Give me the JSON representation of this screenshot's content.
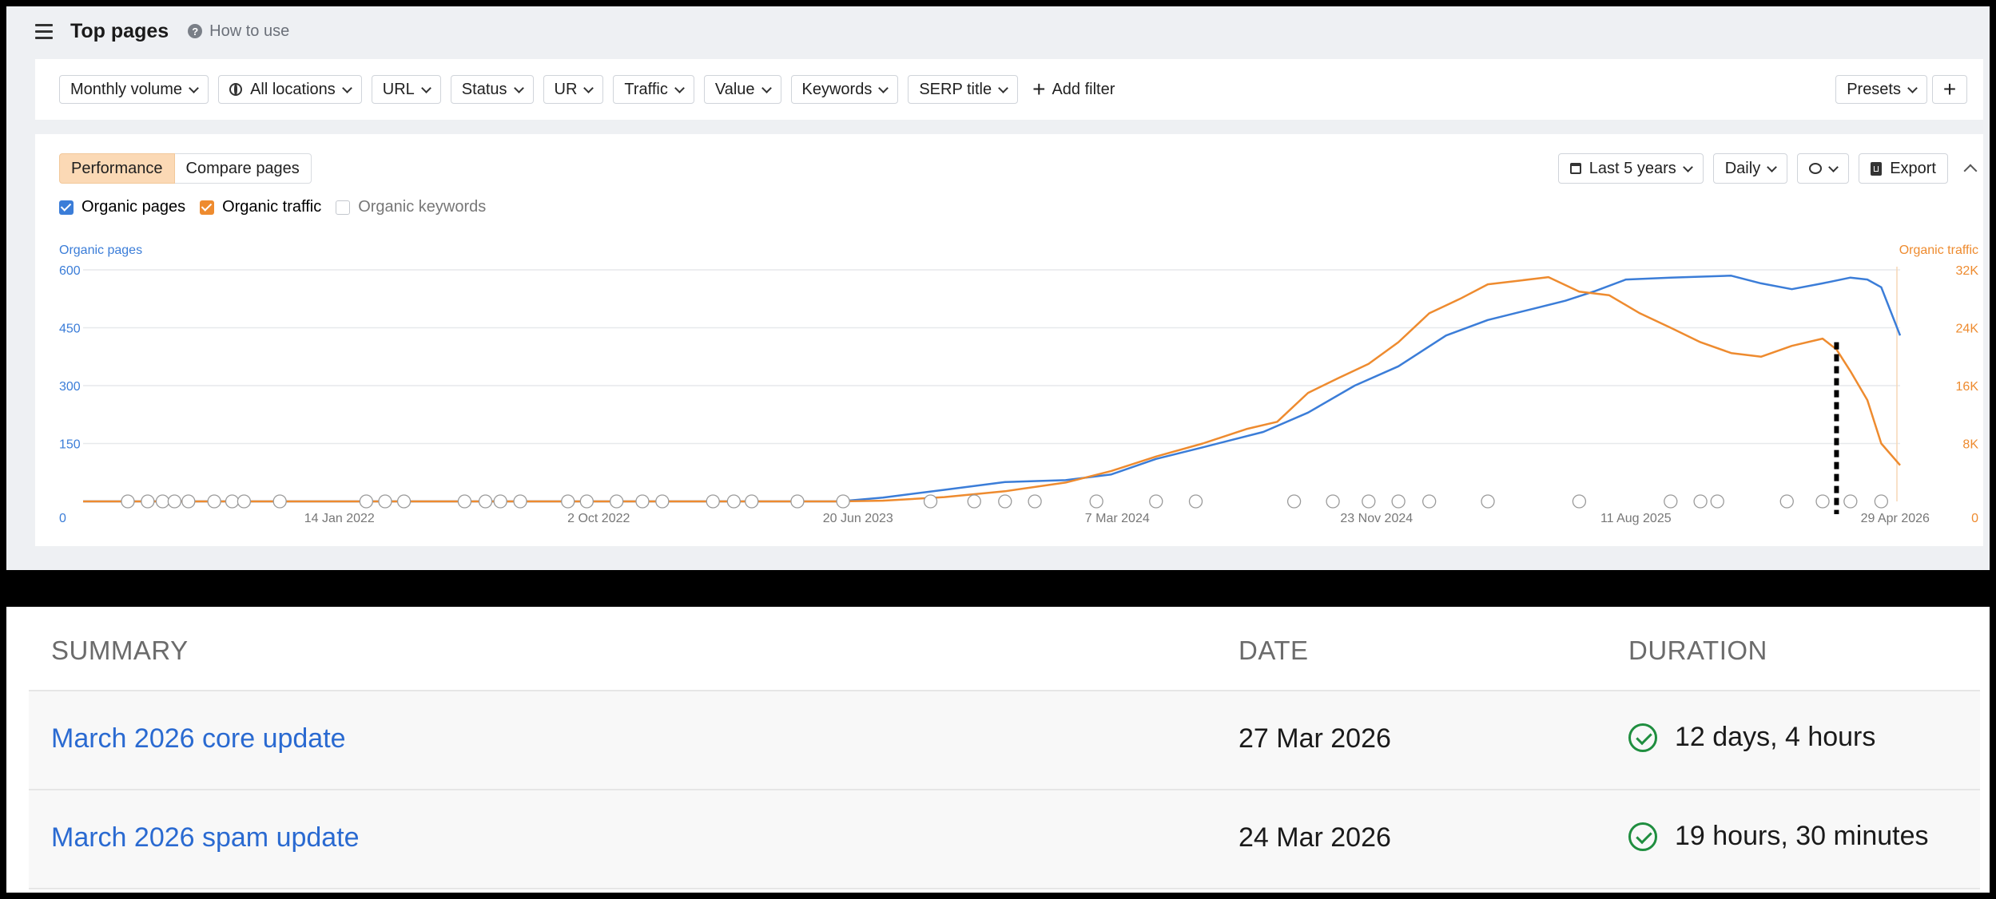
{
  "header": {
    "title": "Top pages",
    "help_label": "How to use",
    "help_icon": "question-circle-icon"
  },
  "filters": {
    "chips": [
      {
        "label": "Monthly volume"
      },
      {
        "label": "All locations",
        "icon": "globe-icon"
      },
      {
        "label": "URL"
      },
      {
        "label": "Status"
      },
      {
        "label": "UR"
      },
      {
        "label": "Traffic"
      },
      {
        "label": "Value"
      },
      {
        "label": "Keywords"
      },
      {
        "label": "SERP title"
      }
    ],
    "add_filter": "Add filter",
    "presets": "Presets",
    "add_symbol": "+"
  },
  "chart_panel": {
    "tabs": [
      {
        "label": "Performance",
        "active": true
      },
      {
        "label": "Compare pages",
        "active": false
      }
    ],
    "date_range": "Last 5 years",
    "interval": "Daily",
    "export": "Export",
    "legend": [
      {
        "label": "Organic pages",
        "checked": true,
        "color": "#3b7dd8"
      },
      {
        "label": "Organic traffic",
        "checked": true,
        "color": "#ee8b2f"
      },
      {
        "label": "Organic keywords",
        "checked": false,
        "color": "#c4c8ce"
      }
    ]
  },
  "chart_data": {
    "type": "line",
    "left_axis_label": "Organic pages",
    "right_axis_label": "Organic traffic",
    "y_left_ticks": [
      "0",
      "150",
      "300",
      "450",
      "600"
    ],
    "y_left_range": [
      0,
      600
    ],
    "y_right_ticks": [
      "0",
      "8K",
      "16K",
      "24K",
      "32K"
    ],
    "y_right_range": [
      0,
      32000
    ],
    "x_ticks": [
      "14 Jan 2022",
      "2 Oct 2022",
      "20 Jun 2023",
      "7 Mar 2024",
      "23 Nov 2024",
      "11 Aug 2025",
      "29 Apr 2026"
    ],
    "x_range": [
      "2021-05-01",
      "2026-05-04"
    ],
    "grid": true,
    "series": [
      {
        "name": "Organic pages",
        "axis": "left",
        "color": "#3b7dd8",
        "points": [
          [
            "2021-05-01",
            0
          ],
          [
            "2023-06-01",
            0
          ],
          [
            "2023-07-15",
            10
          ],
          [
            "2023-09-15",
            30
          ],
          [
            "2023-11-15",
            50
          ],
          [
            "2024-01-15",
            55
          ],
          [
            "2024-03-01",
            70
          ],
          [
            "2024-04-15",
            110
          ],
          [
            "2024-06-01",
            140
          ],
          [
            "2024-08-01",
            180
          ],
          [
            "2024-09-15",
            230
          ],
          [
            "2024-11-01",
            300
          ],
          [
            "2024-12-15",
            350
          ],
          [
            "2025-02-01",
            430
          ],
          [
            "2025-03-15",
            470
          ],
          [
            "2025-05-01",
            500
          ],
          [
            "2025-06-01",
            520
          ],
          [
            "2025-07-01",
            545
          ],
          [
            "2025-08-01",
            575
          ],
          [
            "2025-09-15",
            580
          ],
          [
            "2025-11-15",
            585
          ],
          [
            "2025-12-15",
            565
          ],
          [
            "2026-01-15",
            550
          ],
          [
            "2026-02-15",
            565
          ],
          [
            "2026-03-15",
            580
          ],
          [
            "2026-04-01",
            575
          ],
          [
            "2026-04-15",
            555
          ],
          [
            "2026-05-04",
            430
          ]
        ]
      },
      {
        "name": "Organic traffic",
        "axis": "right",
        "color": "#ee8b2f",
        "points": [
          [
            "2021-05-01",
            0
          ],
          [
            "2023-06-01",
            0
          ],
          [
            "2023-07-15",
            100
          ],
          [
            "2023-09-15",
            600
          ],
          [
            "2023-11-15",
            1400
          ],
          [
            "2024-01-15",
            2600
          ],
          [
            "2024-03-01",
            4200
          ],
          [
            "2024-04-15",
            6200
          ],
          [
            "2024-06-01",
            8000
          ],
          [
            "2024-07-15",
            10000
          ],
          [
            "2024-08-15",
            11000
          ],
          [
            "2024-09-15",
            15000
          ],
          [
            "2024-10-15",
            17000
          ],
          [
            "2024-11-15",
            19000
          ],
          [
            "2024-12-15",
            22000
          ],
          [
            "2025-01-15",
            26000
          ],
          [
            "2025-02-15",
            28000
          ],
          [
            "2025-03-15",
            30000
          ],
          [
            "2025-04-15",
            30500
          ],
          [
            "2025-05-15",
            31000
          ],
          [
            "2025-06-15",
            29000
          ],
          [
            "2025-07-15",
            28500
          ],
          [
            "2025-08-15",
            26000
          ],
          [
            "2025-09-15",
            24000
          ],
          [
            "2025-10-15",
            22000
          ],
          [
            "2025-11-15",
            20500
          ],
          [
            "2025-12-15",
            20000
          ],
          [
            "2026-01-15",
            21500
          ],
          [
            "2026-02-15",
            22500
          ],
          [
            "2026-03-01",
            21000
          ],
          [
            "2026-03-15",
            18000
          ],
          [
            "2026-04-01",
            14000
          ],
          [
            "2026-04-15",
            8000
          ],
          [
            "2026-05-04",
            5000
          ]
        ]
      }
    ],
    "annotation": {
      "type": "dotted-vertical-line",
      "date": "2026-03-01",
      "color": "#000000"
    },
    "event_markers": {
      "icons": [
        "google-update-icon",
        "note-icon"
      ],
      "dates": [
        "2021-06-15",
        "2021-07-05",
        "2021-07-20",
        "2021-08-01",
        "2021-08-15",
        "2021-09-10",
        "2021-09-28",
        "2021-10-10",
        "2021-11-15",
        "2022-02-10",
        "2022-03-01",
        "2022-03-20",
        "2022-05-20",
        "2022-06-10",
        "2022-06-25",
        "2022-07-15",
        "2022-09-01",
        "2022-09-20",
        "2022-10-20",
        "2022-11-15",
        "2022-12-05",
        "2023-01-25",
        "2023-02-15",
        "2023-03-05",
        "2023-04-20",
        "2023-06-05",
        "2023-09-01",
        "2023-10-15",
        "2023-11-15",
        "2023-12-15",
        "2024-02-15",
        "2024-04-15",
        "2024-05-25",
        "2024-09-01",
        "2024-10-10",
        "2024-11-15",
        "2024-12-15",
        "2025-01-15",
        "2025-03-15",
        "2025-06-15",
        "2025-09-15",
        "2025-10-15",
        "2025-11-01",
        "2026-01-10",
        "2026-02-15",
        "2026-03-15",
        "2026-04-15"
      ]
    }
  },
  "table": {
    "headers": [
      "SUMMARY",
      "DATE",
      "DURATION"
    ],
    "rows": [
      {
        "summary": "March 2026 core update",
        "date": "27 Mar 2026",
        "duration": "12 days, 4 hours",
        "status_icon": "check-circle-icon"
      },
      {
        "summary": "March 2026 spam update",
        "date": "24 Mar 2026",
        "duration": "19 hours, 30 minutes",
        "status_icon": "check-circle-icon"
      }
    ],
    "status_color": "#1f8e3f",
    "link_color": "#2a6ad1"
  }
}
